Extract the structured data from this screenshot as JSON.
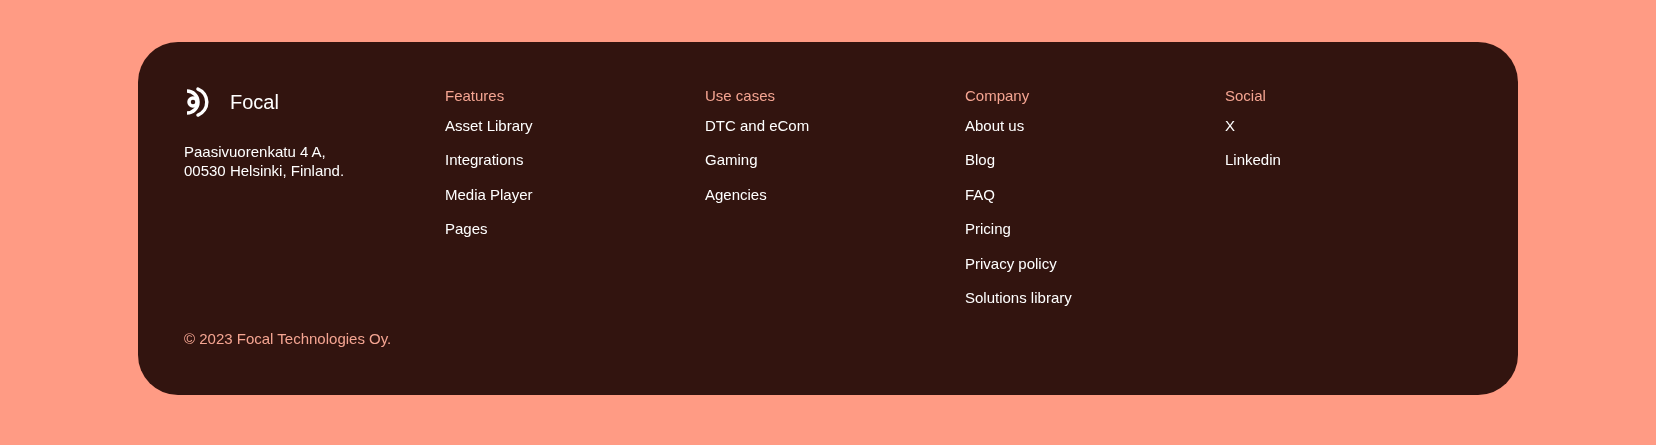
{
  "brand": {
    "name": "Focal",
    "address": [
      "Paasivuorenkatu 4 A,",
      "00530 Helsinki, Finland."
    ]
  },
  "columns": [
    {
      "heading": "Features",
      "links": [
        "Asset Library",
        "Integrations",
        "Media Player",
        "Pages"
      ]
    },
    {
      "heading": "Use cases",
      "links": [
        "DTC and eCom",
        "Gaming",
        "Agencies"
      ]
    },
    {
      "heading": "Company",
      "links": [
        "About us",
        "Blog",
        "FAQ",
        "Pricing",
        "Privacy policy",
        "Solutions library"
      ]
    },
    {
      "heading": "Social",
      "links": [
        "X",
        "Linkedin"
      ]
    }
  ],
  "copyright": "© 2023 Focal Technologies Oy."
}
